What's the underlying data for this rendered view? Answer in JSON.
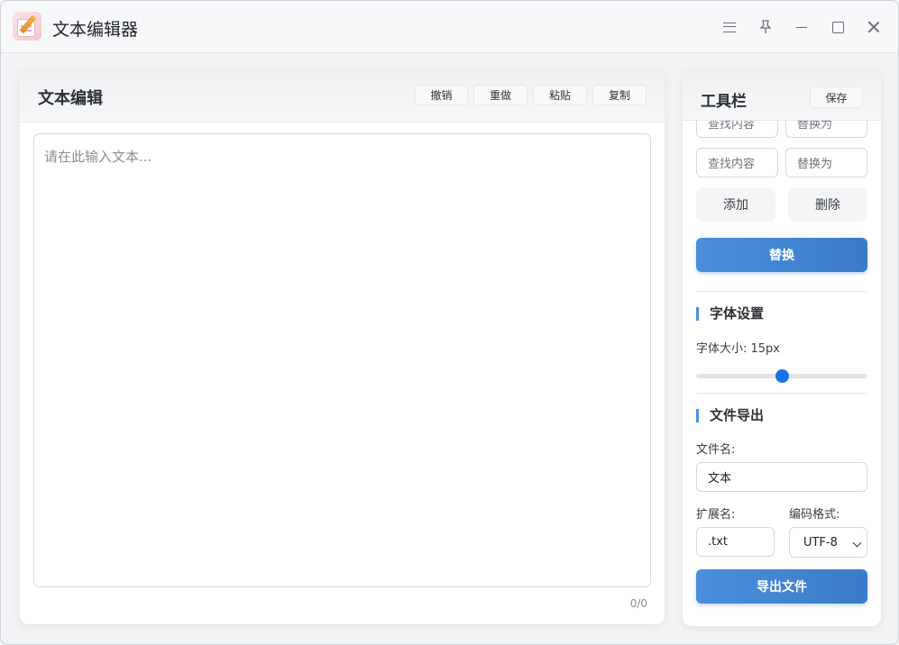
{
  "app": {
    "title": "文本编辑器"
  },
  "window_controls": [
    "menu-icon",
    "pin-icon",
    "minimize-icon",
    "maximize-icon",
    "close-icon"
  ],
  "editor": {
    "title": "文本编辑",
    "buttons": {
      "undo": "撤销",
      "redo": "重做",
      "paste": "粘贴",
      "copy": "复制"
    },
    "placeholder": "请在此输入文本...",
    "counter": "0/0"
  },
  "toolbar": {
    "title": "工具栏",
    "save": "保存",
    "replace_rows": [
      {
        "find_placeholder": "查找内容",
        "replace_placeholder": "替换为"
      },
      {
        "find_placeholder": "查找内容",
        "replace_placeholder": "替换为"
      }
    ],
    "add": "添加",
    "delete": "删除",
    "replace": "替换",
    "font_section": {
      "title": "字体设置",
      "size_label": "字体大小: 15px",
      "slider_fraction": 0.5
    },
    "export_section": {
      "title": "文件导出",
      "filename_label": "文件名:",
      "filename_value": "文本",
      "ext_label": "扩展名:",
      "ext_value": ".txt",
      "encoding_label": "编码格式:",
      "encoding_value": "UTF-8",
      "export_button": "导出文件"
    }
  },
  "colors": {
    "accent": "#4a8fdd",
    "slider": "#1a73e8"
  }
}
